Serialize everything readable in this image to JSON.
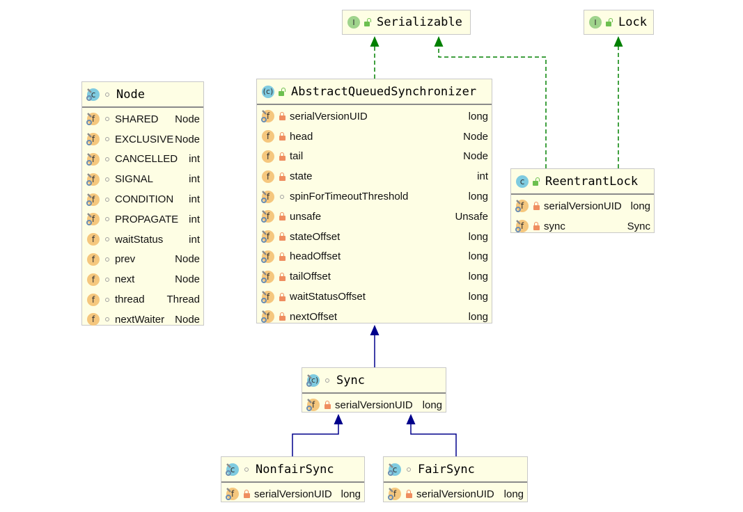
{
  "colors": {
    "box_fill": "#fefee4",
    "realization_edge": "#008000",
    "inheritance_edge": "#00008b"
  },
  "interfaces": [
    {
      "id": "serializable",
      "name": "Serializable",
      "icon": "interface-icon",
      "icon_letter": "I",
      "visibility": "public"
    },
    {
      "id": "lock",
      "name": "Lock",
      "icon": "interface-icon",
      "icon_letter": "I",
      "visibility": "public"
    }
  ],
  "classes": [
    {
      "id": "node",
      "name": "Node",
      "icon_letter": "c",
      "abstract": false,
      "static": true,
      "visibility": "package",
      "fields": [
        {
          "name": "SHARED",
          "type": "Node",
          "static": true,
          "visibility": "package"
        },
        {
          "name": "EXCLUSIVE",
          "type": "Node",
          "static": true,
          "visibility": "package"
        },
        {
          "name": "CANCELLED",
          "type": "int",
          "static": true,
          "visibility": "package"
        },
        {
          "name": "SIGNAL",
          "type": "int",
          "static": true,
          "visibility": "package"
        },
        {
          "name": "CONDITION",
          "type": "int",
          "static": true,
          "visibility": "package"
        },
        {
          "name": "PROPAGATE",
          "type": "int",
          "static": true,
          "visibility": "package"
        },
        {
          "name": "waitStatus",
          "type": "int",
          "static": false,
          "visibility": "package"
        },
        {
          "name": "prev",
          "type": "Node",
          "static": false,
          "visibility": "package"
        },
        {
          "name": "next",
          "type": "Node",
          "static": false,
          "visibility": "package"
        },
        {
          "name": "thread",
          "type": "Thread",
          "static": false,
          "visibility": "package"
        },
        {
          "name": "nextWaiter",
          "type": "Node",
          "static": false,
          "visibility": "package"
        }
      ]
    },
    {
      "id": "aqs",
      "name": "AbstractQueuedSynchronizer",
      "icon_letter": "c",
      "abstract": true,
      "static": false,
      "visibility": "public",
      "fields": [
        {
          "name": "serialVersionUID",
          "type": "long",
          "static": true,
          "visibility": "private"
        },
        {
          "name": "head",
          "type": "Node",
          "static": false,
          "visibility": "private"
        },
        {
          "name": "tail",
          "type": "Node",
          "static": false,
          "visibility": "private"
        },
        {
          "name": "state",
          "type": "int",
          "static": false,
          "visibility": "private"
        },
        {
          "name": "spinForTimeoutThreshold",
          "type": "long",
          "static": true,
          "visibility": "package"
        },
        {
          "name": "unsafe",
          "type": "Unsafe",
          "static": true,
          "visibility": "private"
        },
        {
          "name": "stateOffset",
          "type": "long",
          "static": true,
          "visibility": "private"
        },
        {
          "name": "headOffset",
          "type": "long",
          "static": true,
          "visibility": "private"
        },
        {
          "name": "tailOffset",
          "type": "long",
          "static": true,
          "visibility": "private"
        },
        {
          "name": "waitStatusOffset",
          "type": "long",
          "static": true,
          "visibility": "private"
        },
        {
          "name": "nextOffset",
          "type": "long",
          "static": true,
          "visibility": "private"
        }
      ]
    },
    {
      "id": "reentrantlock",
      "name": "ReentrantLock",
      "icon_letter": "c",
      "abstract": false,
      "static": false,
      "visibility": "public",
      "fields": [
        {
          "name": "serialVersionUID",
          "type": "long",
          "static": true,
          "visibility": "private"
        },
        {
          "name": "sync",
          "type": "Sync",
          "static": true,
          "visibility": "private"
        }
      ]
    },
    {
      "id": "sync",
      "name": "Sync",
      "icon_letter": "c",
      "abstract": true,
      "static": true,
      "visibility": "package",
      "fields": [
        {
          "name": "serialVersionUID",
          "type": "long",
          "static": true,
          "visibility": "private"
        }
      ]
    },
    {
      "id": "nonfairsync",
      "name": "NonfairSync",
      "icon_letter": "c",
      "abstract": false,
      "static": true,
      "visibility": "package",
      "fields": [
        {
          "name": "serialVersionUID",
          "type": "long",
          "static": true,
          "visibility": "private"
        }
      ]
    },
    {
      "id": "fairsync",
      "name": "FairSync",
      "icon_letter": "c",
      "abstract": false,
      "static": true,
      "visibility": "package",
      "fields": [
        {
          "name": "serialVersionUID",
          "type": "long",
          "static": true,
          "visibility": "private"
        }
      ]
    }
  ],
  "relations": [
    {
      "from": "aqs",
      "to": "serializable",
      "kind": "implements"
    },
    {
      "from": "reentrantlock",
      "to": "serializable",
      "kind": "implements"
    },
    {
      "from": "reentrantlock",
      "to": "lock",
      "kind": "implements"
    },
    {
      "from": "sync",
      "to": "aqs",
      "kind": "extends"
    },
    {
      "from": "nonfairsync",
      "to": "sync",
      "kind": "extends"
    },
    {
      "from": "fairsync",
      "to": "sync",
      "kind": "extends"
    }
  ]
}
